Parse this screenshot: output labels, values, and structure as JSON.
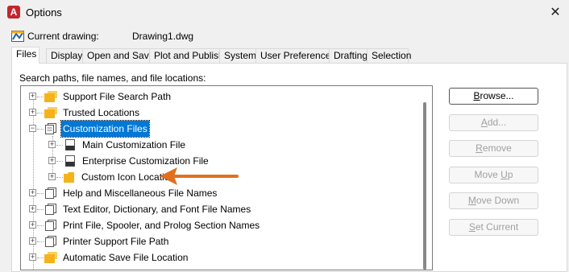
{
  "window": {
    "title": "Options",
    "app_icon": "A"
  },
  "current_drawing": {
    "label": "Current drawing:",
    "value": "Drawing1.dwg"
  },
  "tabs": [
    {
      "label": "Files",
      "active": true
    },
    {
      "label": "Display"
    },
    {
      "label": "Open and Save"
    },
    {
      "label": "Plot and Publish"
    },
    {
      "label": "System"
    },
    {
      "label": "User Preferences"
    },
    {
      "label": "Drafting"
    },
    {
      "label": "Selection"
    }
  ],
  "files_panel": {
    "section_label": "Search paths, file names, and file locations:",
    "tree": [
      {
        "label": "Support File Search Path",
        "icon": "folder-stack-icon",
        "expander": "+"
      },
      {
        "label": "Trusted Locations",
        "icon": "folder-stack-icon",
        "expander": "+"
      },
      {
        "label": "Customization Files",
        "icon": "document-stack-icon",
        "expander": "−",
        "selected": true
      },
      {
        "label": "Main Customization File",
        "icon": "cui-file-icon",
        "expander": "+"
      },
      {
        "label": "Enterprise Customization File",
        "icon": "cui-file-icon",
        "expander": "+"
      },
      {
        "label": "Custom Icon Location",
        "icon": "folder-icon",
        "expander": "+"
      },
      {
        "label": "Help and Miscellaneous File Names",
        "icon": "document-stack-icon",
        "expander": "+"
      },
      {
        "label": "Text Editor, Dictionary, and Font File Names",
        "icon": "document-stack-icon",
        "expander": "+"
      },
      {
        "label": "Print File, Spooler, and Prolog Section Names",
        "icon": "document-stack-icon",
        "expander": "+"
      },
      {
        "label": "Printer Support File Path",
        "icon": "document-stack-icon",
        "expander": "+"
      },
      {
        "label": "Automatic Save File Location",
        "icon": "folder-stack-icon",
        "expander": "+"
      }
    ]
  },
  "buttons": [
    {
      "label": "Browse...",
      "enabled": true,
      "hotkey_index": 0
    },
    {
      "label": "Add...",
      "enabled": false,
      "hotkey_index": 0
    },
    {
      "label": "Remove",
      "enabled": false,
      "hotkey_index": 0
    },
    {
      "label": "Move Up",
      "enabled": false,
      "hotkey_index": 5
    },
    {
      "label": "Move Down",
      "enabled": false,
      "hotkey_index": 0
    },
    {
      "label": "Set Current",
      "enabled": false,
      "hotkey_index": 0
    }
  ],
  "colors": {
    "selection": "#0078d7",
    "annotation_arrow": "#e07020",
    "folder": "#f5b21a",
    "app_icon": "#c1272d"
  }
}
